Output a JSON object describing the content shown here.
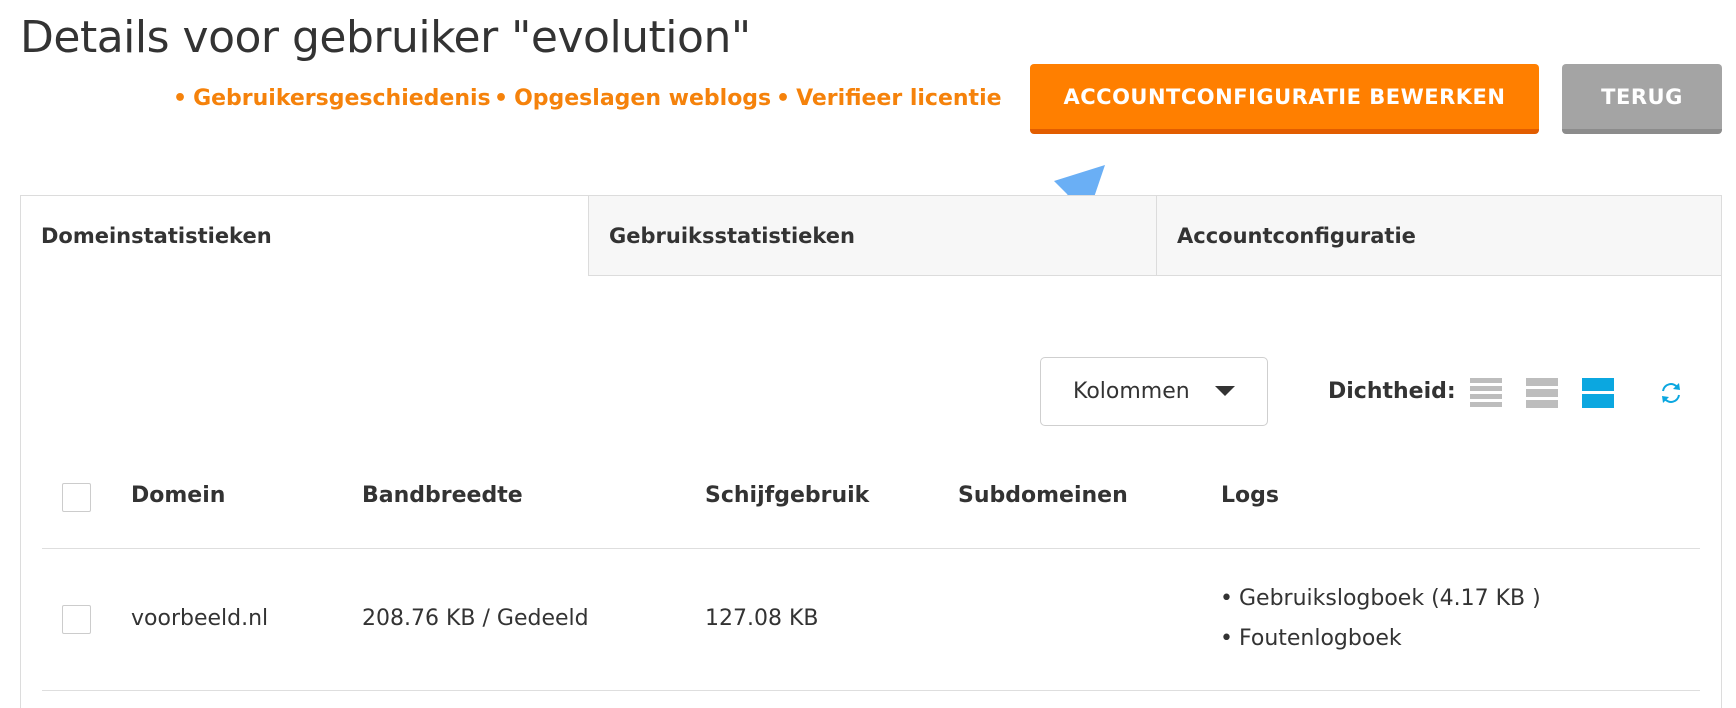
{
  "page": {
    "title": "Details voor gebruiker \"evolution\""
  },
  "quick_links": [
    {
      "label": "Gebruikersgeschiedenis"
    },
    {
      "label": "Opgeslagen weblogs"
    },
    {
      "label": "Verifieer licentie"
    }
  ],
  "actions": {
    "edit_account_label": "ACCOUNTCONFIGURATIE BEWERKEN",
    "back_label": "TERUG"
  },
  "tabs": [
    {
      "label": "Domeinstatistieken",
      "active": true
    },
    {
      "label": "Gebruiksstatistieken",
      "active": false
    },
    {
      "label": "Accountconfiguratie",
      "active": false
    }
  ],
  "toolbar": {
    "columns_label": "Kolommen",
    "density_label": "Dichtheid:",
    "density_options": [
      "compact-icon",
      "comfortable-icon",
      "spacious-icon"
    ],
    "density_selected": 2
  },
  "table": {
    "headers": {
      "domain": "Domein",
      "bandwidth": "Bandbreedte",
      "disk": "Schijfgebruik",
      "subdomains": "Subdomeinen",
      "logs": "Logs"
    },
    "rows": [
      {
        "domain": "voorbeeld.nl",
        "bandwidth": "208.76 KB / Gedeeld",
        "disk": "127.08 KB",
        "subdomains": "",
        "logs": [
          "Gebruikslogboek (4.17 KB )",
          "Foutenlogboek"
        ]
      }
    ]
  },
  "colors": {
    "accent_orange": "#ff7f00",
    "link_orange": "#f5820b",
    "back_gray": "#a4a4a4",
    "density_active": "#0ba7e0",
    "annotation_arrow": "#6aaff5"
  }
}
